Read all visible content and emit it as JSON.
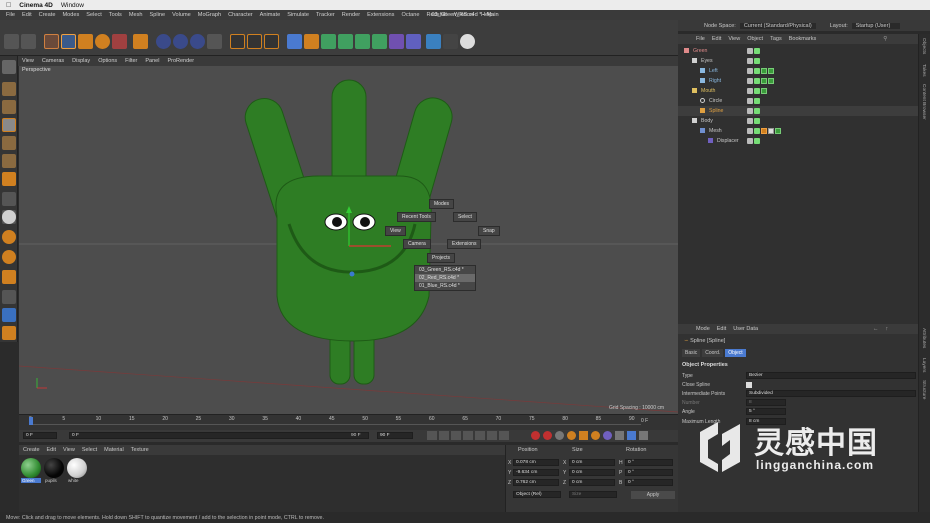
{
  "mac_menu": {
    "app": "Cinema 4D",
    "window": "Window"
  },
  "doc_title": "03_Green_RS.c4d * - Main",
  "main_menu": [
    "File",
    "Edit",
    "Create",
    "Modes",
    "Select",
    "Tools",
    "Mesh",
    "Spline",
    "Volume",
    "MoGraph",
    "Character",
    "Animate",
    "Simulate",
    "Tracker",
    "Render",
    "Extensions",
    "Octane",
    "Redshift",
    "Window",
    "Help"
  ],
  "node_space": {
    "label": "Node Space:",
    "value": "Current (Standard/Physical)"
  },
  "layout": {
    "label": "Layout:",
    "value": "Startup (User)"
  },
  "viewport_menu": [
    "View",
    "Cameras",
    "Display",
    "Options",
    "Filter",
    "Panel",
    "ProRender"
  ],
  "viewport": {
    "label": "Perspective",
    "grid_spacing": "Grid Spacing : 10000 cm"
  },
  "context_menu": {
    "modes": "Modes",
    "recent_tools": "Recent Tools",
    "select": "Select",
    "snap": "Snap",
    "view": "View",
    "camera": "Camera",
    "extensions": "Extensions",
    "projects": "Projects",
    "project_items": [
      "03_Green_RS.c4d *",
      "02_Red_RS.c4d *",
      "01_Blue_RS.c4d *"
    ]
  },
  "timeline": {
    "ticks": [
      "0",
      "5",
      "10",
      "15",
      "20",
      "25",
      "30",
      "35",
      "40",
      "45",
      "50",
      "55",
      "60",
      "65",
      "70",
      "75",
      "80",
      "85",
      "90"
    ],
    "end_label": "0 F"
  },
  "playback": {
    "current": "0 F",
    "start": "0 F",
    "end": "90 F",
    "end2": "90 F"
  },
  "material_menu": [
    "Create",
    "Edit",
    "View",
    "Select",
    "Material",
    "Texture"
  ],
  "materials": [
    {
      "name": "Green",
      "color": "#2f8a2f"
    },
    {
      "name": "pupils",
      "color": "#050505"
    },
    {
      "name": "white",
      "color": "#cfcfcf"
    }
  ],
  "coords": {
    "headers": [
      "Position",
      "Size",
      "Rotation"
    ],
    "rows": [
      {
        "axis": "X",
        "pos": "0.078 cm",
        "size_axis": "X",
        "size": "0 cm",
        "rot_axis": "H",
        "rot": "0 °"
      },
      {
        "axis": "Y",
        "pos": "-9.634 cm",
        "size_axis": "Y",
        "size": "0 cm",
        "rot_axis": "P",
        "rot": "0 °"
      },
      {
        "axis": "Z",
        "pos": "0.762 cm",
        "size_axis": "Z",
        "size": "0 cm",
        "rot_axis": "B",
        "rot": "0 °"
      }
    ],
    "mode": "Object (Rel)",
    "size_mode": "Size",
    "apply": "Apply"
  },
  "object_menu": [
    "File",
    "Edit",
    "View",
    "Object",
    "Tags",
    "Bookmarks"
  ],
  "objects": [
    {
      "name": "Green",
      "indent": 0,
      "color": "#e08a8a",
      "tags": 0
    },
    {
      "name": "Eyes",
      "indent": 1,
      "color": "#d0d0d0",
      "tags": 0
    },
    {
      "name": "Left",
      "indent": 2,
      "color": "#8ab8e0",
      "tags": 2
    },
    {
      "name": "Right",
      "indent": 2,
      "color": "#8ab8e0",
      "tags": 2
    },
    {
      "name": "Mouth",
      "indent": 1,
      "color": "#e0c060",
      "tags": 1
    },
    {
      "name": "Circle",
      "indent": 2,
      "color": "#d0d0d0",
      "tags": 0
    },
    {
      "name": "Spline",
      "indent": 2,
      "color": "#e0a040",
      "tags": 0
    },
    {
      "name": "Body",
      "indent": 1,
      "color": "#d0d0d0",
      "tags": 0
    },
    {
      "name": "Mesh",
      "indent": 2,
      "color": "#d0d0d0",
      "tags": 3
    },
    {
      "name": "Displacer",
      "indent": 3,
      "color": "#d0d0d0",
      "tags": 0
    }
  ],
  "attr_menu": [
    "Mode",
    "Edit",
    "User Data"
  ],
  "attributes": {
    "object_title": "Spline [Spline]",
    "tabs": [
      "Basic",
      "Coord.",
      "Object"
    ],
    "section": "Object Properties",
    "fields": [
      {
        "label": "Type",
        "value": "Bezier"
      },
      {
        "label": "Close Spline",
        "value": ""
      },
      {
        "label": "Intermediate Points",
        "value": "Subdivided"
      },
      {
        "label": "Number",
        "value": "8"
      },
      {
        "label": "Angle",
        "value": "5 °"
      },
      {
        "label": "Maximum Length",
        "value": "8 cm"
      }
    ]
  },
  "side_tabs": [
    "Objects",
    "Takes",
    "Content Browser"
  ],
  "side_tabs_lower": [
    "Attributes",
    "Layers",
    "Structure"
  ],
  "status_text": "Move: Click and drag to move elements. Hold down SHIFT to quantize movement / add to the selection in point mode, CTRL to remove.",
  "watermark": {
    "cn": "灵感中国",
    "en": "lingganchina.com"
  }
}
